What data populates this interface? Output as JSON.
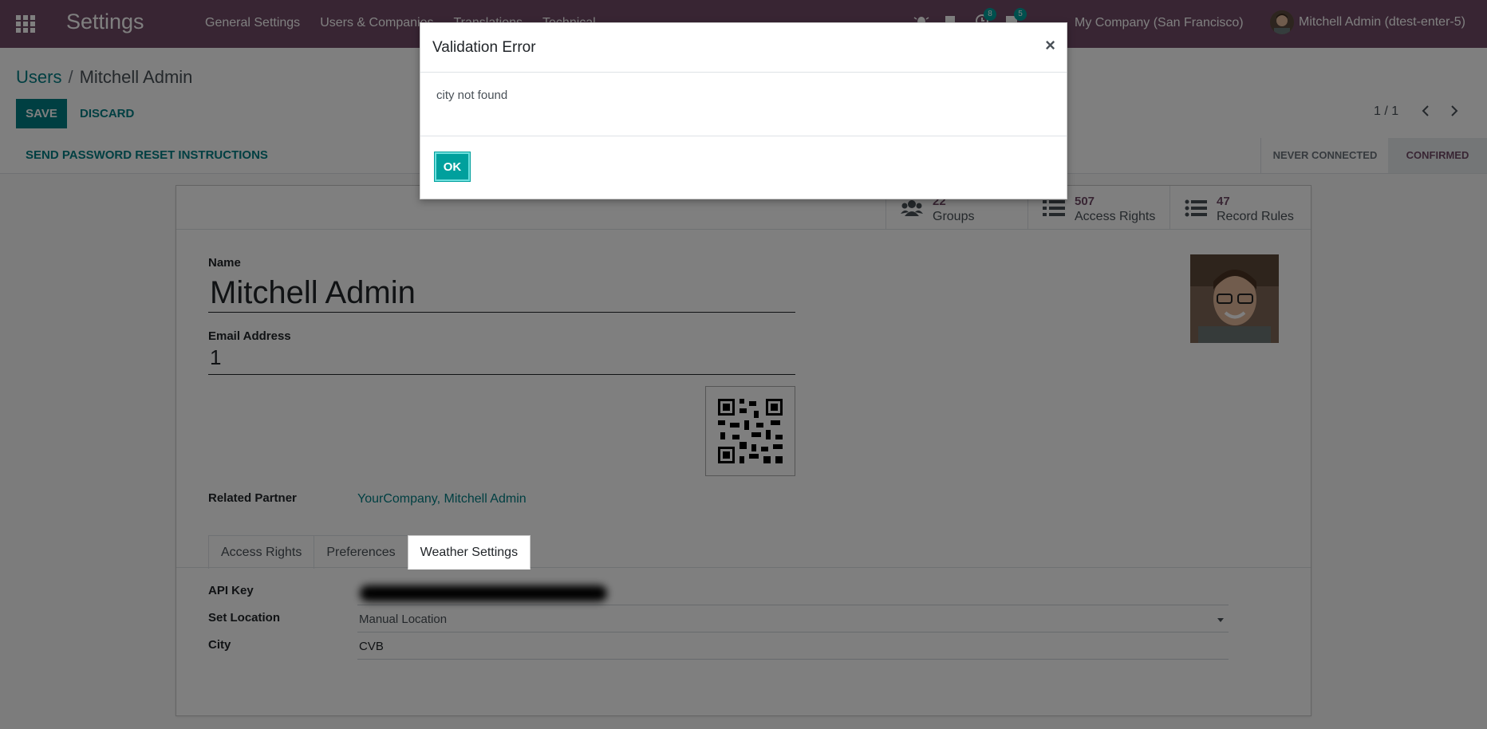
{
  "navbar": {
    "app_title": "Settings",
    "menu": [
      "General Settings",
      "Users & Companies",
      "Translations",
      "Technical"
    ],
    "activity_count": "8",
    "message_count": "5",
    "company": "My Company (San Francisco)",
    "user": "Mitchell Admin (dtest-enter-5)",
    "colors": {
      "brand": "#714b67",
      "accent": "#017e84"
    }
  },
  "breadcrumb": {
    "parent": "Users",
    "separator": "/",
    "current": "Mitchell Admin"
  },
  "actions": {
    "save": "SAVE",
    "discard": "DISCARD"
  },
  "pager": {
    "value": "1 / 1",
    "prev_icon": "chevron-left-icon",
    "next_icon": "chevron-right-icon"
  },
  "statusbar": {
    "reset_button": "SEND PASSWORD RESET INSTRUCTIONS",
    "stages": [
      "NEVER CONNECTED",
      "CONFIRMED"
    ],
    "active_stage": "CONFIRMED"
  },
  "stats": [
    {
      "count": "22",
      "label": "Groups",
      "icon": "users-icon"
    },
    {
      "count": "507",
      "label": "Access Rights",
      "icon": "list-icon"
    },
    {
      "count": "47",
      "label": "Record Rules",
      "icon": "list-icon"
    }
  ],
  "form": {
    "name_label": "Name",
    "name_value": "Mitchell Admin",
    "email_label": "Email Address",
    "email_value": "1",
    "related_partner_label": "Related Partner",
    "related_partner_value": "YourCompany, Mitchell Admin"
  },
  "tabs": [
    "Access Rights",
    "Preferences",
    "Weather Settings"
  ],
  "active_tab": "Weather Settings",
  "weather": {
    "api_key_label": "API Key",
    "set_location_label": "Set Location",
    "set_location_value": "Manual Location",
    "city_label": "City",
    "city_value": "CVB"
  },
  "dialog": {
    "title": "Validation Error",
    "close": "×",
    "message": "city not found",
    "ok": "OK"
  }
}
